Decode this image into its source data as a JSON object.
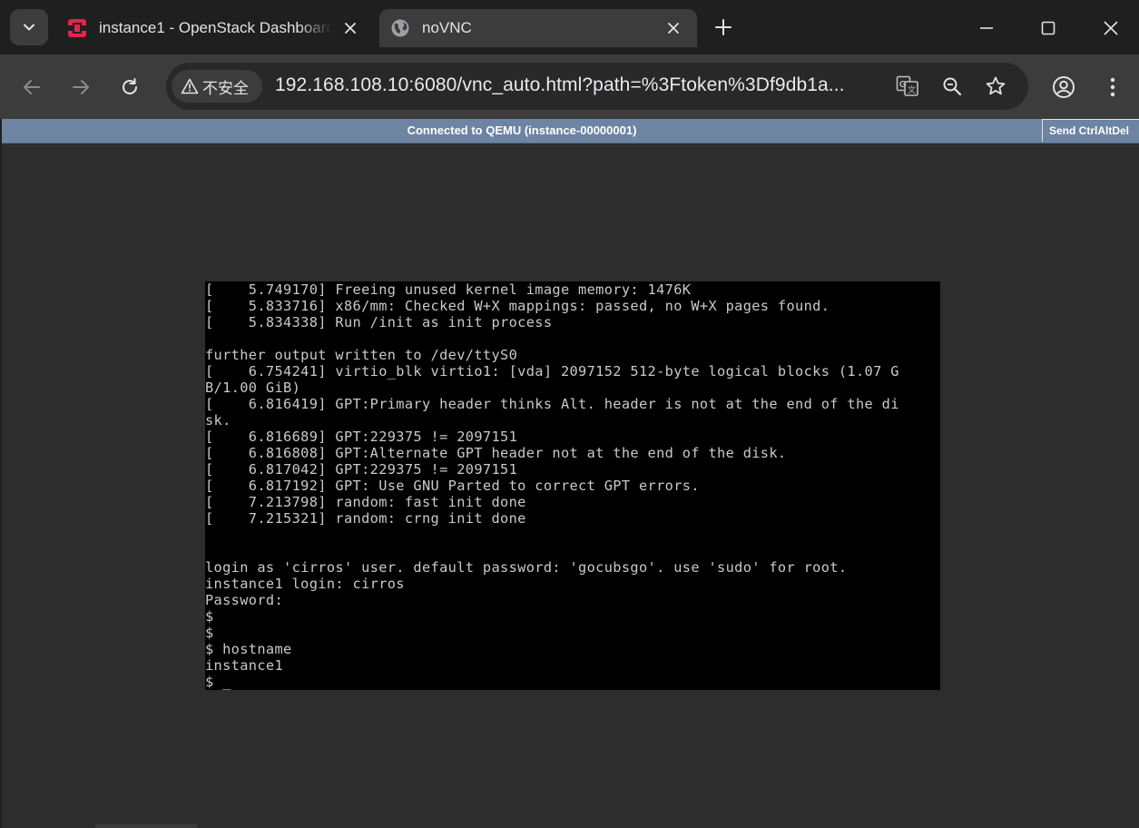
{
  "browser": {
    "tabs": [
      {
        "title": "instance1 - OpenStack Dashboard",
        "favicon": "openstack-icon",
        "active": false
      },
      {
        "title": "noVNC",
        "favicon": "globe-icon",
        "active": true
      }
    ],
    "security_label": "不安全",
    "url": "192.168.108.10:6080/vnc_auto.html?path=%3Ftoken%3Df9db1a...",
    "colors": {
      "tabstrip": "#1f1f1f",
      "toolbar": "#3c3c3c",
      "omnibox": "#282828"
    }
  },
  "novnc": {
    "status": "Connected to QEMU (instance-00000001)",
    "send_ctrl_alt_del": "Send CtrlAltDel",
    "bar_color": "#6d84a2"
  },
  "console_lines": [
    "[    5.749170] Freeing unused kernel image memory: 1476K",
    "[    5.833716] x86/mm: Checked W+X mappings: passed, no W+X pages found.",
    "[    5.834338] Run /init as init process",
    "",
    "further output written to /dev/ttyS0",
    "[    6.754241] virtio_blk virtio1: [vda] 2097152 512-byte logical blocks (1.07 G",
    "B/1.00 GiB)",
    "[    6.816419] GPT:Primary header thinks Alt. header is not at the end of the di",
    "sk.",
    "[    6.816689] GPT:229375 != 2097151",
    "[    6.816808] GPT:Alternate GPT header not at the end of the disk.",
    "[    6.817042] GPT:229375 != 2097151",
    "[    6.817192] GPT: Use GNU Parted to correct GPT errors.",
    "[    7.213798] random: fast init done",
    "[    7.215321] random: crng init done",
    "",
    "",
    "login as 'cirros' user. default password: 'gocubsgo'. use 'sudo' for root.",
    "instance1 login: cirros",
    "Password:",
    "$",
    "$",
    "$ hostname",
    "instance1",
    "$ _"
  ]
}
